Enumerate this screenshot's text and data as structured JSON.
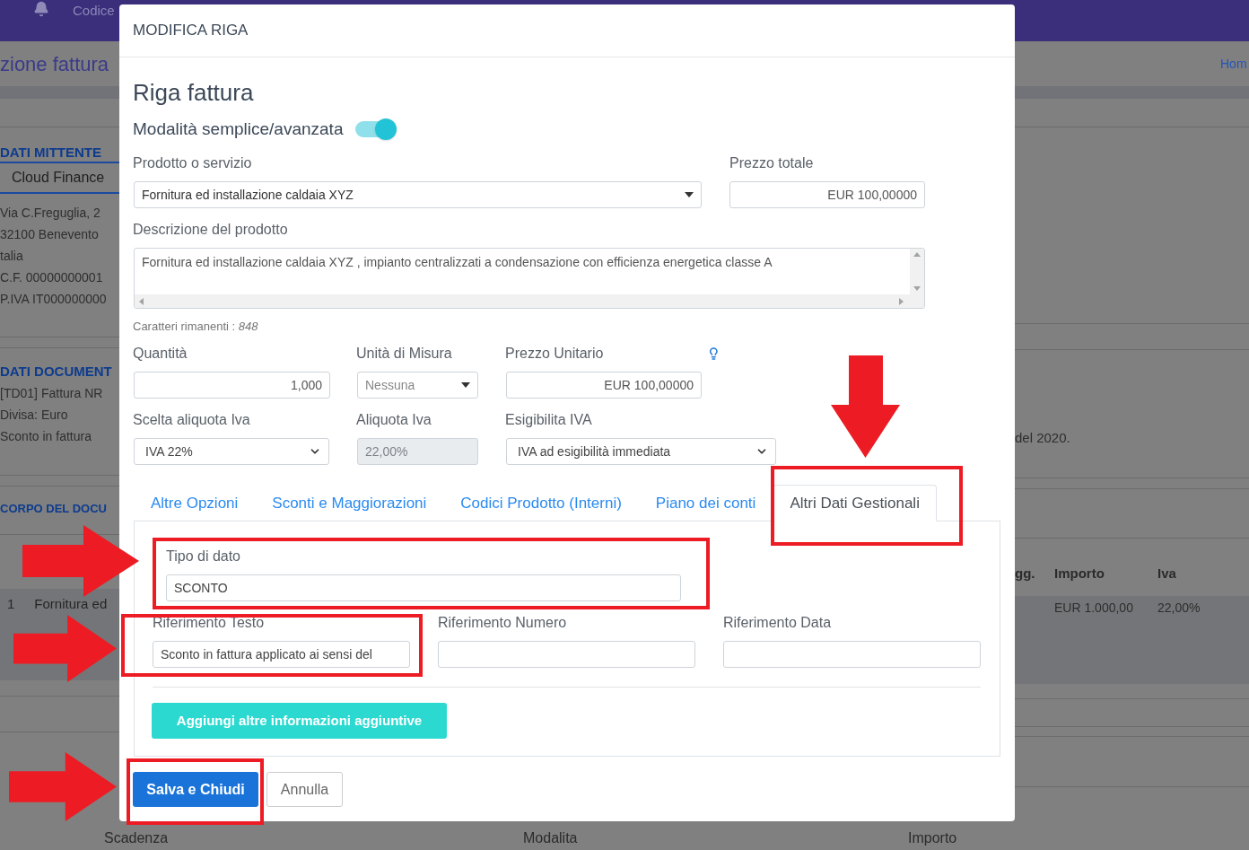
{
  "background": {
    "top_bar": {
      "label": "Codice"
    },
    "page_title": "zione fattura",
    "breadcrumb": "Hom",
    "sender": {
      "heading": "DATI MITTENTE",
      "tab": "Cloud Finance",
      "lines": [
        "Via C.Freguglia, 2",
        "32100 Benevento",
        "talia",
        "C.F. 00000000001",
        "P.IVA IT000000000"
      ]
    },
    "document": {
      "heading": "DATI DOCUMENT",
      "lines": [
        "[TD01] Fattura NR",
        "Divisa: Euro",
        "Sconto in fattura"
      ],
      "line_end": "del 2020."
    },
    "body": {
      "heading": "CORPO DEL DOCU",
      "columns": [
        "gg.",
        "Importo",
        "Iva"
      ],
      "row": {
        "number": "1",
        "description": "Fornitura ed",
        "amount": "EUR 1.000,00",
        "vat": "22,00%"
      }
    },
    "payments": {
      "columns": [
        "Scadenza",
        "Modalita",
        "Importo"
      ]
    }
  },
  "modal": {
    "title": "MODIFICA RIGA",
    "heading": "Riga fattura",
    "mode_toggle": {
      "label": "Modalità semplice/avanzata",
      "on": true
    },
    "product": {
      "label": "Prodotto o servizio",
      "value": "Fornitura ed installazione caldaia XYZ"
    },
    "total_price": {
      "label": "Prezzo totale",
      "value": "EUR 100,00000"
    },
    "description": {
      "label": "Descrizione del prodotto",
      "value": "Fornitura ed installazione caldaia XYZ , impianto centralizzati a condensazione con efficienza energetica classe A"
    },
    "remaining_chars": "Caratteri rimanenti : *848*",
    "rows": [
      [
        {
          "kind": "number",
          "label": "Quantità",
          "value": "1,000",
          "disabled": false
        },
        {
          "kind": "dropdown",
          "label": "Unità di Misura",
          "value": "Nessuna",
          "disabled": false
        },
        {
          "kind": "number",
          "label": "Prezzo Unitario",
          "value": "EUR 100,00000",
          "disabled": false
        }
      ],
      [
        {
          "kind": "select",
          "label": "Scelta aliquota Iva",
          "value": "IVA 22%",
          "disabled": false
        },
        {
          "kind": "text",
          "label": "Aliquota Iva",
          "value": "22,00%",
          "disabled": true
        },
        {
          "kind": "select",
          "label": "Esigibilita IVA",
          "value": "IVA ad esigibilità immediata",
          "disabled": false
        }
      ]
    ],
    "tabs": [
      {
        "label": "Altre Opzioni",
        "selected": false
      },
      {
        "label": "Sconti e Maggiorazioni",
        "selected": false
      },
      {
        "label": "Codici Prodotto (Interni)",
        "selected": false
      },
      {
        "label": "Piano dei conti",
        "selected": false
      },
      {
        "label": "Altri Dati Gestionali",
        "selected": true
      }
    ],
    "data_type": {
      "label": "Tipo di dato",
      "value": "SCONTO"
    },
    "references": [
      {
        "label": "Riferimento Testo",
        "value": "Sconto in fattura applicato ai sensi del"
      },
      {
        "label": "Riferimento Numero"
      },
      {
        "label": "Riferimento Data"
      }
    ],
    "add_button": "Aggiungi altre informazioni aggiuntive",
    "buttons": [
      {
        "label": "Salva e Chiudi",
        "kind": "primary"
      },
      {
        "label": "Annulla",
        "kind": "secondary"
      }
    ]
  }
}
